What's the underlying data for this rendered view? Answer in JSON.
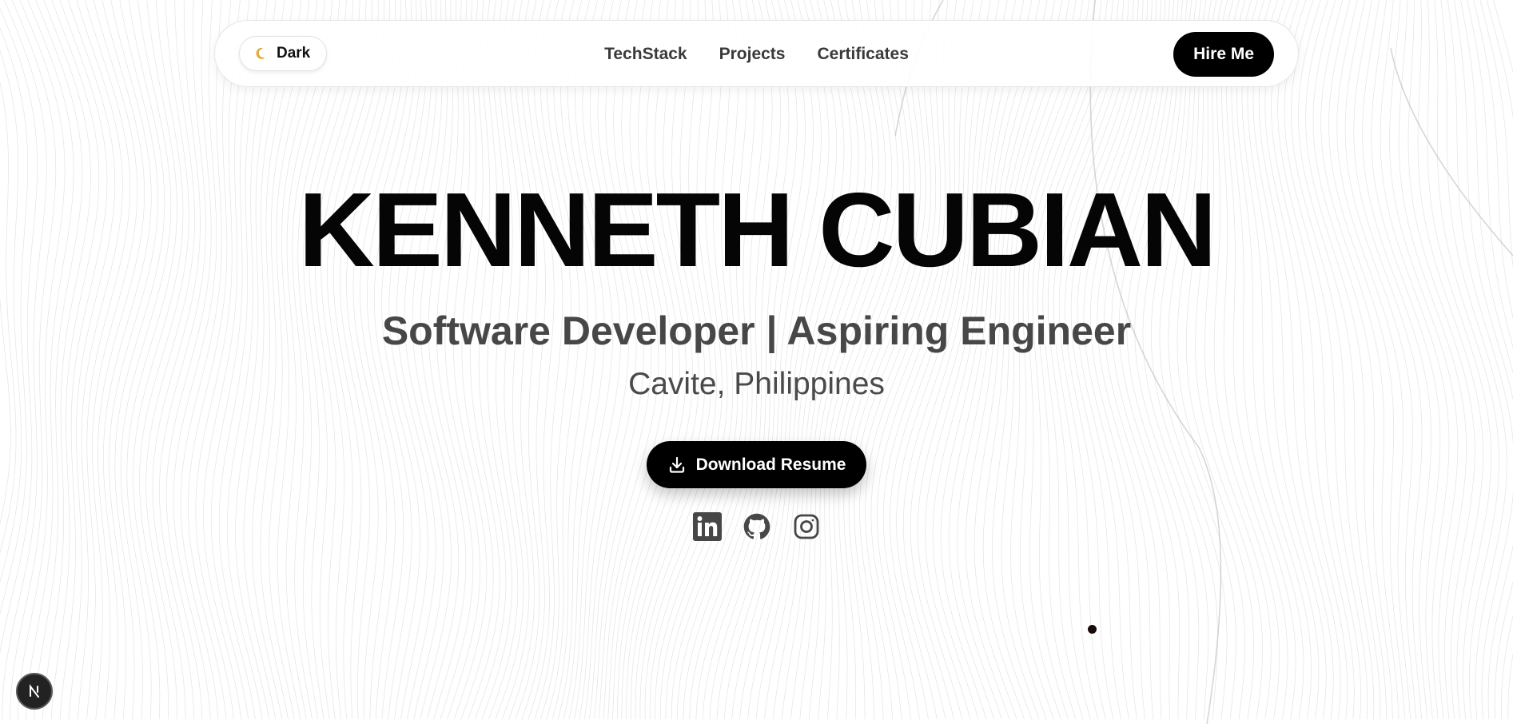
{
  "nav": {
    "theme_toggle_label": "Dark",
    "theme_toggle_icon": "moon-icon",
    "links": [
      {
        "label": "TechStack"
      },
      {
        "label": "Projects"
      },
      {
        "label": "Certificates"
      }
    ],
    "cta_label": "Hire Me"
  },
  "hero": {
    "name": "KENNETH CUBIAN",
    "role": "Software Developer | Aspiring Engineer",
    "location": "Cavite, Philippines",
    "download_label": "Download Resume",
    "download_icon": "download-icon"
  },
  "socials": [
    {
      "icon": "linkedin-icon"
    },
    {
      "icon": "github-icon"
    },
    {
      "icon": "instagram-icon"
    }
  ],
  "dev_badge": {
    "icon": "nextjs-icon",
    "glyph": "N"
  },
  "colors": {
    "background": "#ffffff",
    "primary": "#000000",
    "text_muted": "#474747",
    "line": "#d9d9d9"
  }
}
